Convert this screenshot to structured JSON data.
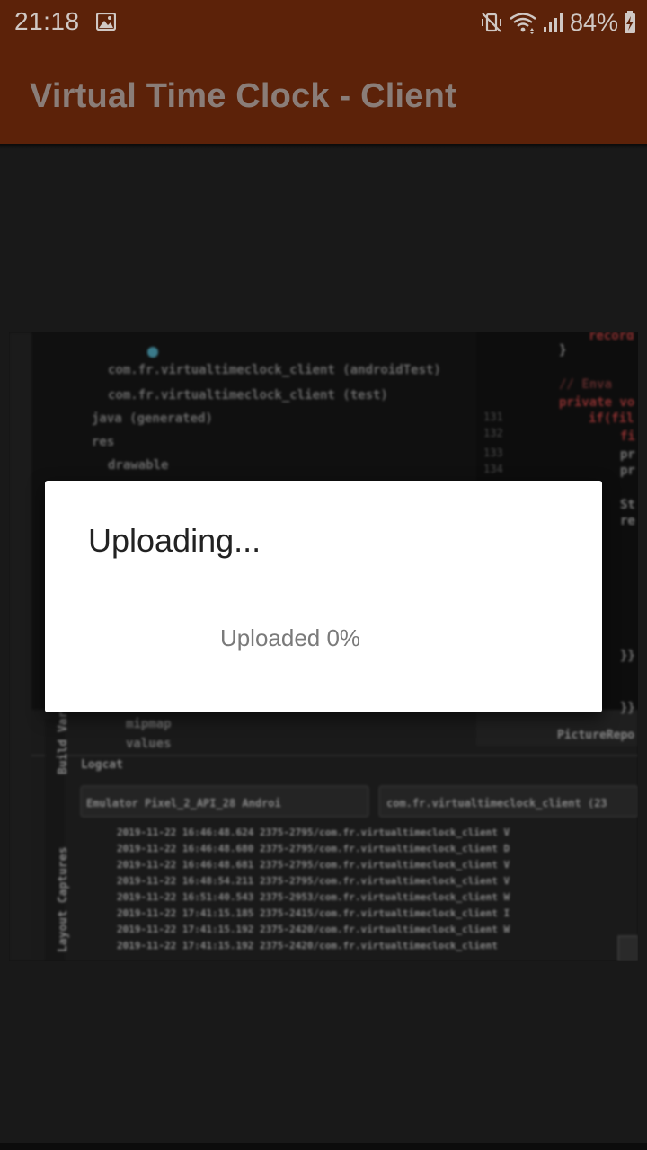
{
  "status_bar": {
    "time": "21:18",
    "battery": "84%",
    "icons": [
      "image-icon",
      "vibrate-mute-icon",
      "wifi-icon",
      "signal-icon",
      "battery-charging-icon"
    ]
  },
  "app_bar": {
    "title": "Virtual Time Clock - Client",
    "background": "#5c2209"
  },
  "photo": {
    "tree_items": [
      "com.fr.virtualtimeclock_client (androidTest)",
      "com.fr.virtualtimeclock_client (test)",
      "java (generated)",
      "res",
      "drawable",
      "mipmap",
      "values"
    ],
    "panel_labels": [
      "Logcat",
      "Build Variants",
      "Layout Captures",
      "PictureRepo"
    ],
    "logcat_device": "Emulator Pixel_2_API_28 Androi",
    "logcat_package": "com.fr.virtualtimeclock_client (23",
    "logcat_lines": [
      "2019-11-22 16:46:48.624 2375-2795/com.fr.virtualtimeclock_client V",
      "2019-11-22 16:46:48.680 2375-2795/com.fr.virtualtimeclock_client D",
      "2019-11-22 16:46:48.681 2375-2795/com.fr.virtualtimeclock_client V",
      "2019-11-22 16:48:54.211 2375-2795/com.fr.virtualtimeclock_client V",
      "2019-11-22 16:51:40.543 2375-2953/com.fr.virtualtimeclock_client W",
      "2019-11-22 17:41:15.185 2375-2415/com.fr.virtualtimeclock_client I",
      "2019-11-22 17:41:15.192 2375-2420/com.fr.virtualtimeclock_client W",
      "2019-11-22 17:41:15.192 2375-2420/com.fr.virtualtimeclock_client"
    ],
    "code_lines": [
      "record",
      "}",
      "// Enva",
      "private vo",
      "if(fil",
      "fi",
      "pr",
      "pr",
      "St",
      "re",
      "}}",
      "}}"
    ],
    "line_numbers": [
      "131",
      "132",
      "133",
      "134"
    ]
  },
  "dialog": {
    "title": "Uploading...",
    "message": "Uploaded 0%",
    "progress_percent": 0
  }
}
